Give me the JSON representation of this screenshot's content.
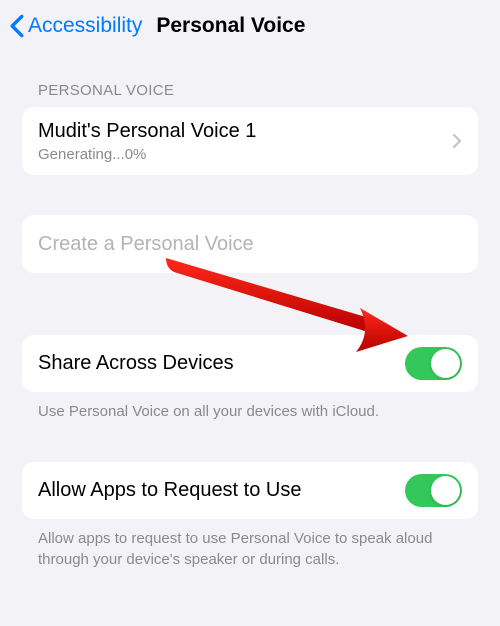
{
  "header": {
    "back_label": "Accessibility",
    "title": "Personal Voice"
  },
  "section_headers": {
    "personal_voice": "PERSONAL VOICE"
  },
  "voice_item": {
    "title": "Mudit's Personal Voice 1",
    "subtitle": "Generating...0%"
  },
  "create": {
    "label": "Create a Personal Voice"
  },
  "share": {
    "label": "Share Across Devices",
    "footer": "Use Personal Voice on all your devices with iCloud.",
    "on": true
  },
  "allow_apps": {
    "label": "Allow Apps to Request to Use",
    "footer": "Allow apps to request to use Personal Voice to speak aloud through your device's speaker or during calls.",
    "on": true
  },
  "colors": {
    "accent": "#007aff",
    "toggle_on": "#34c759",
    "arrow": "#d40000"
  }
}
